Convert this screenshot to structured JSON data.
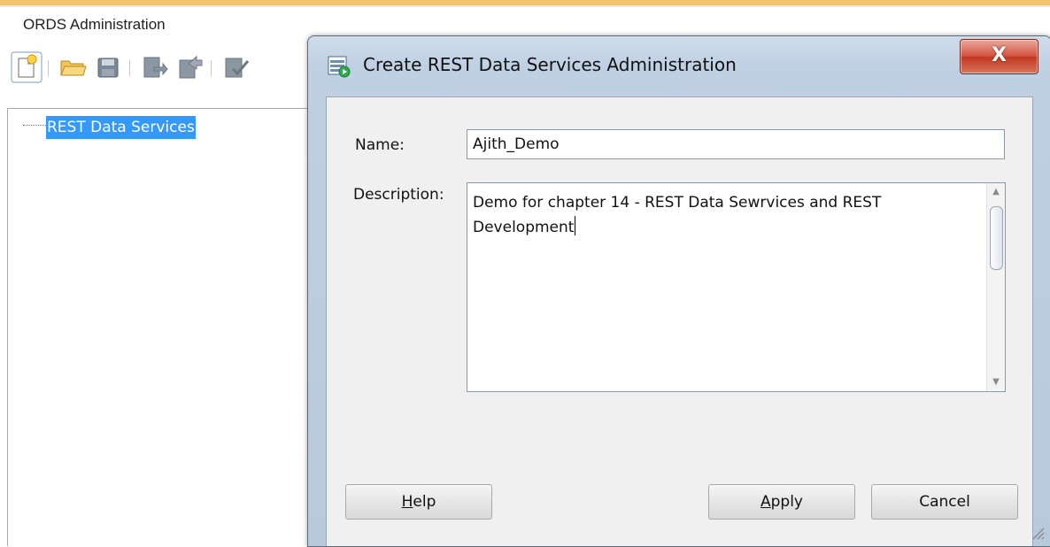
{
  "panel": {
    "title": "ORDS Administration",
    "toolbar_icons": [
      "new-icon",
      "open-folder-icon",
      "save-icon",
      "import-icon",
      "export-icon",
      "validate-icon"
    ]
  },
  "tree": {
    "root_label": "REST Data Services"
  },
  "dialog": {
    "title": "Create REST Data Services Administration",
    "close_label": "X",
    "name_label": "Name:",
    "name_value": "Ajith_Demo",
    "description_label": "Description:",
    "description_value": "Demo for chapter 14 - REST Data Sewrvices and REST\nDevelopment",
    "buttons": {
      "help": "Help",
      "apply": "Apply",
      "cancel": "Cancel"
    }
  },
  "colors": {
    "selection": "#3399ff",
    "close_button": "#c1381f",
    "top_accent": "#f2c36b"
  }
}
